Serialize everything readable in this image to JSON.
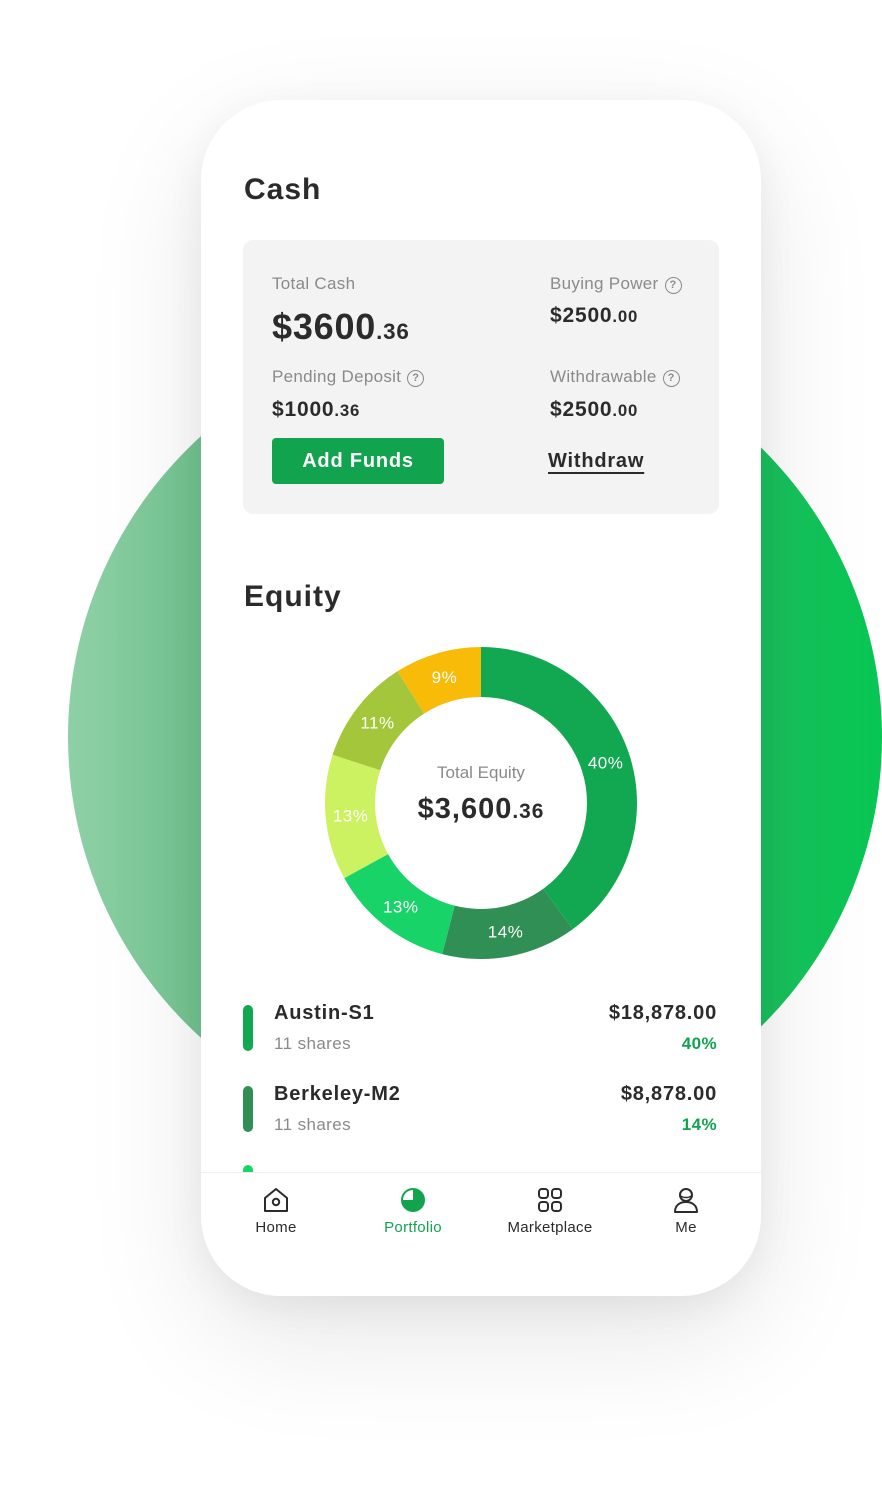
{
  "cash": {
    "title": "Cash",
    "total_cash_label": "Total Cash",
    "total_cash_int": "$3600",
    "total_cash_dec": ".36",
    "buying_power_label": "Buying Power",
    "buying_power_int": "$2500",
    "buying_power_dec": ".00",
    "pending_deposit_label": "Pending Deposit",
    "pending_deposit_int": "$1000",
    "pending_deposit_dec": ".36",
    "withdrawable_label": "Withdrawable",
    "withdrawable_int": "$2500",
    "withdrawable_dec": ".00",
    "add_funds_label": "Add Funds",
    "withdraw_label": "Withdraw",
    "help_glyph": "?"
  },
  "equity": {
    "title": "Equity",
    "center_label": "Total Equity",
    "center_value_int": "$3,600",
    "center_value_dec": ".36"
  },
  "chart_data": {
    "type": "pie",
    "values": [
      40,
      14,
      13,
      13,
      11,
      9
    ],
    "labels": [
      "40%",
      "14%",
      "13%",
      "13%",
      "11%",
      "9%"
    ],
    "colors": [
      "#12a852",
      "#2f8f55",
      "#18d468",
      "#cdf261",
      "#a4c63a",
      "#f8bb08"
    ]
  },
  "holdings": [
    {
      "name": "Austin-S1",
      "shares": "11 shares",
      "amount": "$18,878.00",
      "pct": "40%",
      "color": "#12a852"
    },
    {
      "name": "Berkeley-M2",
      "shares": "11 shares",
      "amount": "$8,878.00",
      "pct": "14%",
      "color": "#2f8f55"
    }
  ],
  "tabs": [
    {
      "label": "Home",
      "icon": "home-icon",
      "active": false
    },
    {
      "label": "Portfolio",
      "icon": "portfolio-icon",
      "active": true
    },
    {
      "label": "Marketplace",
      "icon": "marketplace-icon",
      "active": false
    },
    {
      "label": "Me",
      "icon": "user-icon",
      "active": false
    }
  ],
  "colors": {
    "accent": "#11a34e",
    "text": "#2b2b2b",
    "muted": "#8a8a8a"
  }
}
